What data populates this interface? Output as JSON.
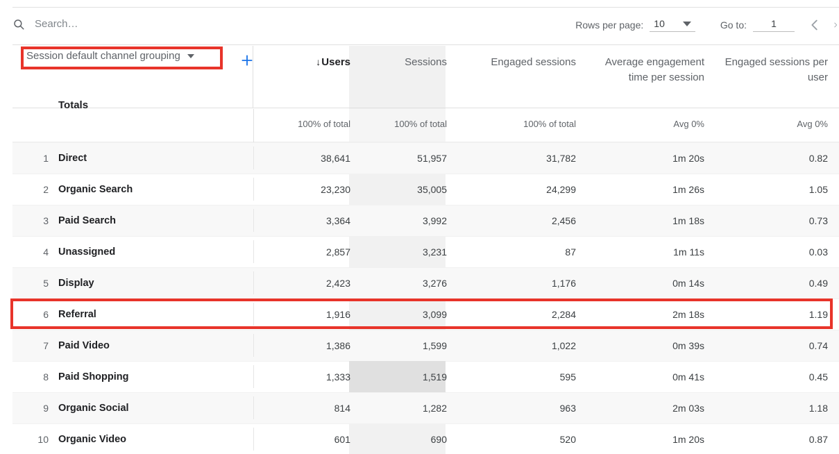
{
  "toolbar": {
    "search_placeholder": "Search…",
    "search_value": "",
    "search_icon": "search-icon",
    "rows_per_page_label": "Rows per page:",
    "rows_per_page_value": "10",
    "goto_label": "Go to:",
    "goto_value": "1",
    "prev_icon": "chevron-left-icon",
    "next_icon": "chevron-right-icon"
  },
  "dimension": {
    "label": "Session default channel grouping",
    "caret_icon": "chevron-down-icon",
    "add_icon": "plus-icon"
  },
  "columns": [
    {
      "label": "Users",
      "sorted": true,
      "sort_icon": "↓"
    },
    {
      "label": "Sessions",
      "sorted": false,
      "highlighted": true
    },
    {
      "label": "Engaged sessions",
      "sorted": false
    },
    {
      "label": "Average engagement time per session",
      "sorted": false
    },
    {
      "label": "Engaged sessions per user",
      "sorted": false
    }
  ],
  "totals": {
    "label": "Totals",
    "values": [
      "100% of total",
      "100% of total",
      "100% of total",
      "Avg 0%",
      "Avg 0%"
    ]
  },
  "rows": [
    {
      "index": "1",
      "name": "Direct",
      "users": "38,641",
      "sessions": "51,957",
      "engaged_sessions": "31,782",
      "avg_engagement": "1m 20s",
      "engaged_per_user": "0.82"
    },
    {
      "index": "2",
      "name": "Organic Search",
      "users": "23,230",
      "sessions": "35,005",
      "engaged_sessions": "24,299",
      "avg_engagement": "1m 26s",
      "engaged_per_user": "1.05"
    },
    {
      "index": "3",
      "name": "Paid Search",
      "users": "3,364",
      "sessions": "3,992",
      "engaged_sessions": "2,456",
      "avg_engagement": "1m 18s",
      "engaged_per_user": "0.73"
    },
    {
      "index": "4",
      "name": "Unassigned",
      "users": "2,857",
      "sessions": "3,231",
      "engaged_sessions": "87",
      "avg_engagement": "1m 11s",
      "engaged_per_user": "0.03"
    },
    {
      "index": "5",
      "name": "Display",
      "users": "2,423",
      "sessions": "3,276",
      "engaged_sessions": "1,176",
      "avg_engagement": "0m 14s",
      "engaged_per_user": "0.49"
    },
    {
      "index": "6",
      "name": "Referral",
      "users": "1,916",
      "sessions": "3,099",
      "engaged_sessions": "2,284",
      "avg_engagement": "2m 18s",
      "engaged_per_user": "1.19"
    },
    {
      "index": "7",
      "name": "Paid Video",
      "users": "1,386",
      "sessions": "1,599",
      "engaged_sessions": "1,022",
      "avg_engagement": "0m 39s",
      "engaged_per_user": "0.74"
    },
    {
      "index": "8",
      "name": "Paid Shopping",
      "users": "1,333",
      "sessions": "1,519",
      "engaged_sessions": "595",
      "avg_engagement": "0m 41s",
      "engaged_per_user": "0.45"
    },
    {
      "index": "9",
      "name": "Organic Social",
      "users": "814",
      "sessions": "1,282",
      "engaged_sessions": "963",
      "avg_engagement": "2m 03s",
      "engaged_per_user": "1.18"
    },
    {
      "index": "10",
      "name": "Organic Video",
      "users": "601",
      "sessions": "690",
      "engaged_sessions": "520",
      "avg_engagement": "1m 20s",
      "engaged_per_user": "0.87"
    }
  ],
  "annotations": {
    "highlight_color": "#e8342a",
    "targets": [
      "dimension-chip",
      "row-6-referral"
    ]
  },
  "accent_color": "#1a73e8"
}
